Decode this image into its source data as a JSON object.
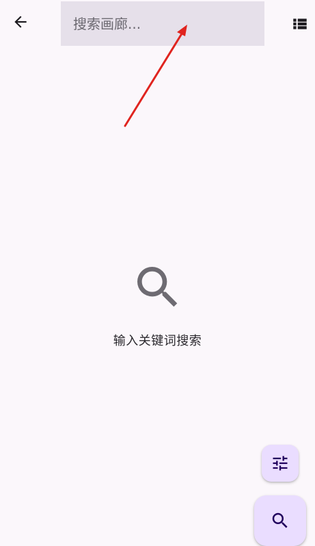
{
  "toolbar": {
    "back_icon": "arrow-left-icon",
    "search_placeholder": "搜索画廊...",
    "search_value": "",
    "view_toggle_icon": "list-view-icon"
  },
  "empty_state": {
    "icon": "search-icon",
    "message": "输入关键词搜索"
  },
  "fabs": {
    "filter_icon": "tune-icon",
    "search_icon": "search-icon"
  },
  "colors": {
    "background": "#fbf7fb",
    "search_box": "#e6e0ea",
    "fab": "#eaddff",
    "annotation_arrow": "#e0241f",
    "empty_icon": "#6e6b72"
  }
}
